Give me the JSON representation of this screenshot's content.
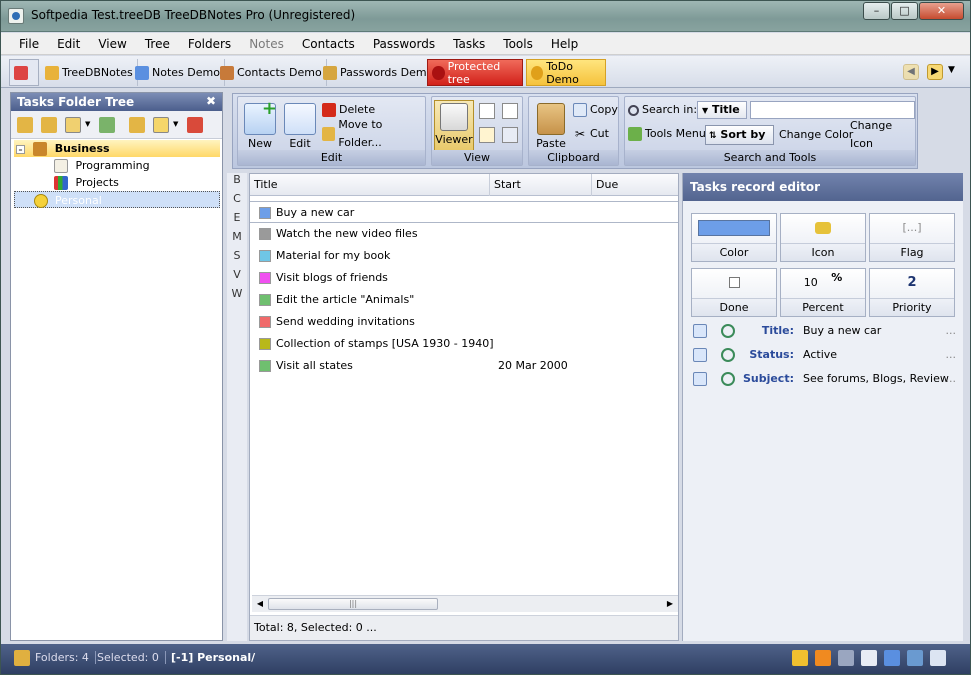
{
  "window": {
    "title": "Softpedia Test.treeDB TreeDBNotes Pro (Unregistered)"
  },
  "menu": [
    "File",
    "Edit",
    "View",
    "Tree",
    "Folders",
    "Notes",
    "Contacts",
    "Passwords",
    "Tasks",
    "Tools",
    "Help"
  ],
  "demo_tabs": [
    "TreeDBNotes",
    "Notes Demo",
    "Contacts Demo",
    "Passwords Demo",
    "Protected tree",
    "ToDo Demo"
  ],
  "tree_panel": {
    "title": "Tasks Folder Tree",
    "items": [
      "Business",
      "Programming",
      "Projects",
      "Personal"
    ]
  },
  "ribbon": {
    "edit": {
      "new": "New",
      "edit": "Edit",
      "delete": "Delete",
      "move": "Move to Folder...",
      "label": "Edit"
    },
    "view": {
      "viewer": "Viewer",
      "label": "View"
    },
    "clipboard": {
      "paste": "Paste",
      "copy": "Copy",
      "cut": "Cut",
      "label": "Clipboard"
    },
    "search": {
      "search_in": "Search in:",
      "field": "Title",
      "tools_menu": "Tools Menu",
      "sort_by": "Sort by",
      "change_color": "Change Color",
      "change_icon": "Change Icon",
      "label": "Search and Tools"
    }
  },
  "alpha_index": [
    "B",
    "C",
    "E",
    "M",
    "S",
    "V",
    "W"
  ],
  "grid": {
    "columns": [
      "Title",
      "Start",
      "Due"
    ],
    "rows": [
      {
        "title": "Buy a new car",
        "start": "",
        "color": "#6d9ee8"
      },
      {
        "title": "Watch the new video files",
        "start": "",
        "color": "#9a9a9a"
      },
      {
        "title": "Material for my book",
        "start": "",
        "color": "#6fc6e6"
      },
      {
        "title": "Visit blogs of friends",
        "start": "",
        "color": "#f050f0"
      },
      {
        "title": "Edit the article \"Animals\"",
        "start": "",
        "color": "#6fbf6f"
      },
      {
        "title": "Send wedding invitations",
        "start": "",
        "color": "#f06a6a"
      },
      {
        "title": "Collection of stamps [USA 1930 - 1940]",
        "start": "",
        "color": "#b8b81a"
      },
      {
        "title": "Visit all states",
        "start": "20 Mar 2000",
        "color": "#6fbf6f"
      }
    ],
    "footer": "Total: 8, Selected: 0 ..."
  },
  "editor": {
    "title": "Tasks record editor",
    "tiles": {
      "color": "Color",
      "icon": "Icon",
      "flag": "Flag",
      "flag_value": "[...]",
      "done": "Done",
      "percent": "Percent",
      "percent_value": "10",
      "percent_sign": "%",
      "priority": "Priority",
      "priority_value": "2"
    },
    "fields": [
      {
        "label": "Title:",
        "value": "Buy a new car"
      },
      {
        "label": "Status:",
        "value": "Active"
      },
      {
        "label": "Subject:",
        "value": "See forums, Blogs, Review"
      }
    ]
  },
  "status": {
    "folders": "Folders: 4",
    "selected": "Selected: 0",
    "path": "[-1] Personal/"
  }
}
